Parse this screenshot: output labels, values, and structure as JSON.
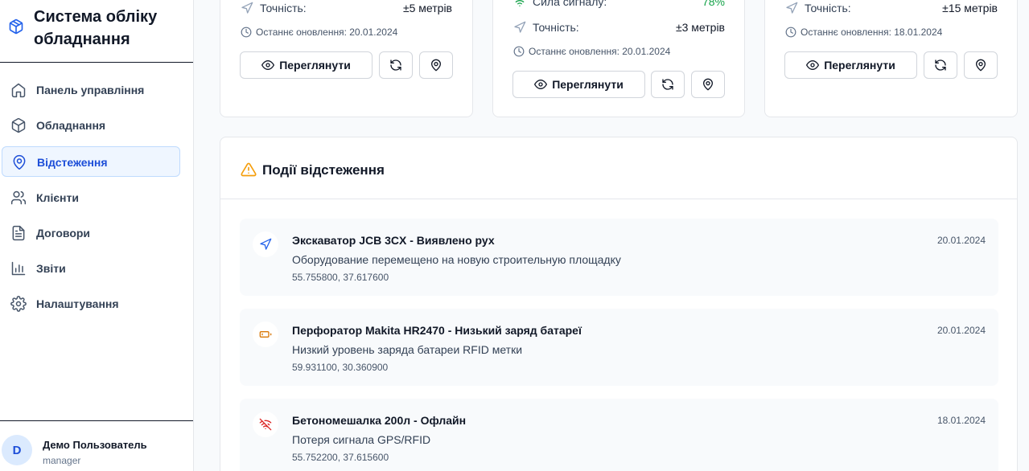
{
  "app": {
    "title": "Система обліку обладнання"
  },
  "sidebar": {
    "items": [
      {
        "label": "Панель управління",
        "icon": "home-icon"
      },
      {
        "label": "Обладнання",
        "icon": "package-icon"
      },
      {
        "label": "Відстеження",
        "icon": "map-pin-icon",
        "active": true
      },
      {
        "label": "Клієнти",
        "icon": "users-icon"
      },
      {
        "label": "Договори",
        "icon": "file-text-icon"
      },
      {
        "label": "Звіти",
        "icon": "bar-chart-icon"
      },
      {
        "label": "Налаштування",
        "icon": "settings-icon"
      }
    ]
  },
  "user": {
    "initial": "D",
    "name": "Демо Пользователь",
    "role": "manager"
  },
  "cards": [
    {
      "accuracy_label": "Точність:",
      "accuracy_value": "±5 метрів",
      "updated": "Останнє оновлення: 20.01.2024",
      "view_label": "Переглянути"
    },
    {
      "signal_label": "Сила сигналу:",
      "signal_value": "78%",
      "accuracy_label": "Точність:",
      "accuracy_value": "±3 метрів",
      "updated": "Останнє оновлення: 20.01.2024",
      "view_label": "Переглянути"
    },
    {
      "accuracy_label": "Точність:",
      "accuracy_value": "±15 метрів",
      "updated": "Останнє оновлення: 18.01.2024",
      "view_label": "Переглянути"
    }
  ],
  "events": {
    "title": "Події відстеження",
    "items": [
      {
        "title": "Экскаватор JCB 3CX - Виявлено рух",
        "description": "Оборудование перемещено на новую строительную площадку",
        "coords": "55.755800, 37.617600",
        "date": "20.01.2024",
        "icon": "navigation-icon",
        "color": "#2563eb"
      },
      {
        "title": "Перфоратор Makita HR2470 - Низький заряд батареї",
        "description": "Низкий уровень заряда батареи RFID метки",
        "coords": "59.931100, 30.360900",
        "date": "20.01.2024",
        "icon": "battery-low-icon",
        "color": "#d97706"
      },
      {
        "title": "Бетономешалка 200л - Офлайн",
        "description": "Потеря сигнала GPS/RFID",
        "coords": "55.752200, 37.615600",
        "date": "18.01.2024",
        "icon": "wifi-off-icon",
        "color": "#dc2626"
      }
    ]
  },
  "colors": {
    "accent": "#2563eb",
    "success": "#16a34a",
    "warning": "#f59e0b"
  }
}
